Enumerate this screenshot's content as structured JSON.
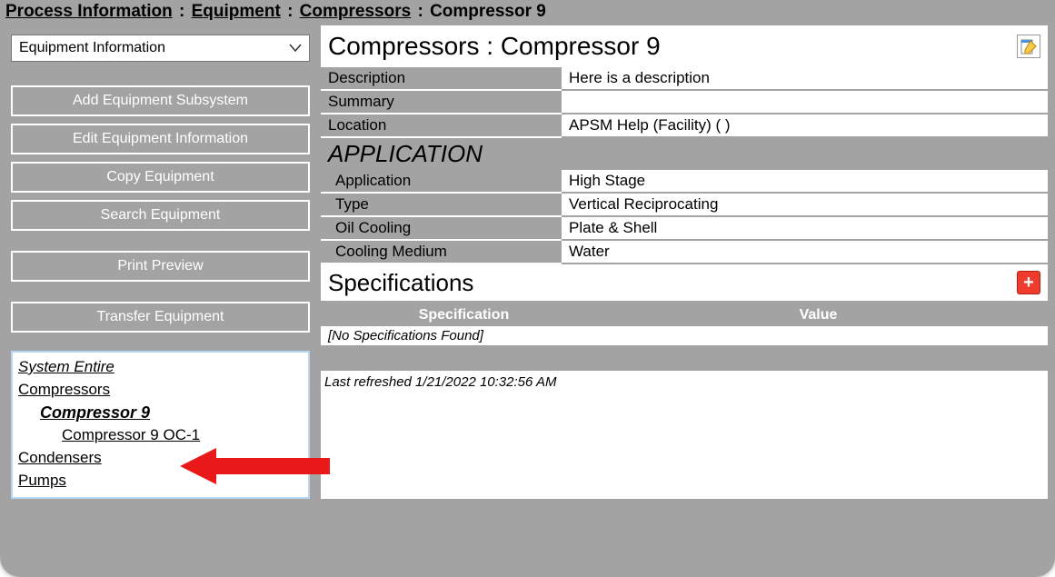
{
  "breadcrumb": {
    "items": [
      "Process Information",
      "Equipment",
      "Compressors"
    ],
    "current": "Compressor 9",
    "sep": ":"
  },
  "sidebar": {
    "select_label": "Equipment Information",
    "buttons": {
      "add_subsystem": "Add Equipment Subsystem",
      "edit_info": "Edit Equipment Information",
      "copy": "Copy Equipment",
      "search": "Search Equipment",
      "print": "Print Preview",
      "transfer": "Transfer Equipment"
    },
    "tree": {
      "system_entire": "System Entire",
      "compressors": "Compressors",
      "compressor9": "Compressor 9",
      "compressor9_oc1": "Compressor 9 OC-1",
      "condensers": "Condensers",
      "pumps": "Pumps"
    }
  },
  "content": {
    "title": "Compressors : Compressor 9",
    "rows": {
      "description_label": "Description",
      "description_value": "Here is a description",
      "summary_label": "Summary",
      "summary_value": "",
      "location_label": "Location",
      "location_value": "APSM Help (Facility) ( )"
    },
    "application_header": "APPLICATION",
    "app_rows": {
      "application_label": "Application",
      "application_value": "High Stage",
      "type_label": "Type",
      "type_value": "Vertical Reciprocating",
      "oil_label": "Oil Cooling",
      "oil_value": "Plate & Shell",
      "medium_label": "Cooling Medium",
      "medium_value": "Water"
    },
    "spec_header": "Specifications",
    "spec_cols": {
      "c1": "Specification",
      "c2": "Value"
    },
    "spec_none": "[No Specifications Found]",
    "refreshed": "Last refreshed 1/21/2022 10:32:56 AM"
  }
}
